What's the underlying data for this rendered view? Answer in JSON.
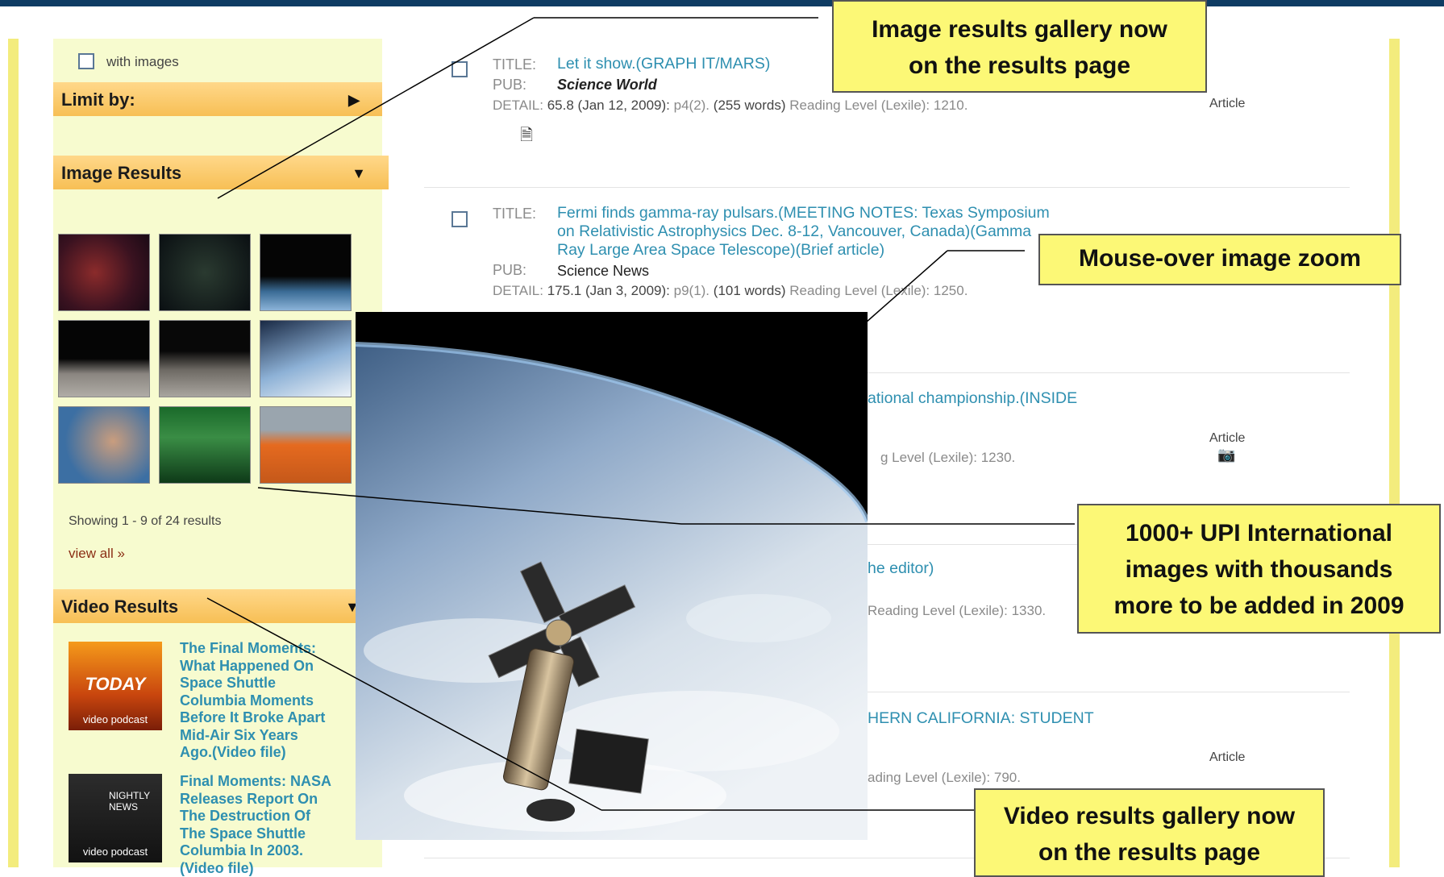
{
  "sidebar": {
    "with_images_label": "with images",
    "limit_by": "Limit by:",
    "image_results": {
      "heading": "Image Results",
      "showing": "Showing 1 - 9  of  24 results",
      "view_all": "view all »"
    },
    "video_results": {
      "heading": "Video Results",
      "items": [
        {
          "title": "The Final Moments:\nWhat Happened On\nSpace Shuttle\nColumbia Moments\nBefore It Broke Apart\nMid-Air Six Years\nAgo.(Video file)",
          "thumb_top": "TODAY",
          "thumb_caption": "video podcast"
        },
        {
          "title": "Final Moments: NASA\nReleases Report On\nThe Destruction Of\nThe Space Shuttle\nColumbia In 2003.\n(Video file)",
          "thumb_top": "NIGHTLY NEWS",
          "thumb_caption": "video podcast"
        }
      ]
    }
  },
  "results": {
    "labels": {
      "title": "TITLE:",
      "pub": "PUB:",
      "detail": "DETAIL:"
    },
    "items": [
      {
        "title": "Let it show.(GRAPH IT/MARS)",
        "pub": "Science World",
        "detail_main": "65.8 (Jan 12, 2009):",
        "page": "p4(2).",
        "words": "(255 words)",
        "reading": "Reading Level (Lexile): 1210.",
        "type": "Article"
      },
      {
        "title": "Fermi finds gamma-ray pulsars.(MEETING NOTES: Texas Symposium\non Relativistic Astrophysics Dec. 8-12, Vancouver, Canada)(Gamma\nRay Large Area Space Telescope)(Brief article)",
        "pub": "Science News",
        "detail_main": "175.1 (Jan 3, 2009):",
        "page": "p9(1).",
        "words": "(101 words)",
        "reading": "Reading Level (Lexile): 1250.",
        "type": ""
      }
    ],
    "partial": [
      {
        "title_frag": "ational championship.(INSIDE",
        "detail_frag": "g Level (Lexile): 1230.",
        "type": "Article"
      },
      {
        "title_frag": "he editor)",
        "detail_frag": "Reading Level (Lexile): 1330."
      },
      {
        "title_frag": "HERN CALIFORNIA: STUDENT",
        "detail_frag": "ading Level (Lexile): 790.",
        "type": "Article"
      }
    ]
  },
  "callouts": {
    "gallery": "Image results gallery now\non the results page",
    "zoom": "Mouse-over image zoom",
    "upi": "1000+ UPI International\nimages with thousands\nmore to be added in 2009",
    "video": "Video results gallery now\non the results page"
  },
  "icons": {
    "doc": "document-icon",
    "camera": "camera-icon",
    "arrow_right": "triangle-right-icon",
    "arrow_down": "triangle-down-icon"
  },
  "colors": {
    "link_blue": "#2e8fb0",
    "header_orange": "#f7bf55",
    "sidebar_bg": "#f7fbcf",
    "callout_yellow": "#fcf876",
    "topbar": "#0f3c63"
  }
}
